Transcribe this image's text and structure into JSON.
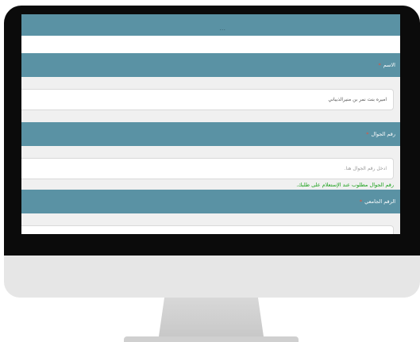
{
  "form": {
    "top_partial_text": "...",
    "name_label": "الاسم",
    "name_value": "اميره بنت نمر بن منيرالذبياني",
    "mobile_label": "رقم الجوال",
    "mobile_placeholder": "ادخل رقم الجوال هنا.",
    "mobile_hint": "رقم الجوال مطلوب عند الإستعلام على طلبك.",
    "university_id_label": "الرقم الجامعي",
    "required_mark": "*"
  },
  "colors": {
    "section_header": "#5a92a4",
    "hint_text": "#18a018",
    "required_mark": "#e8503a"
  }
}
